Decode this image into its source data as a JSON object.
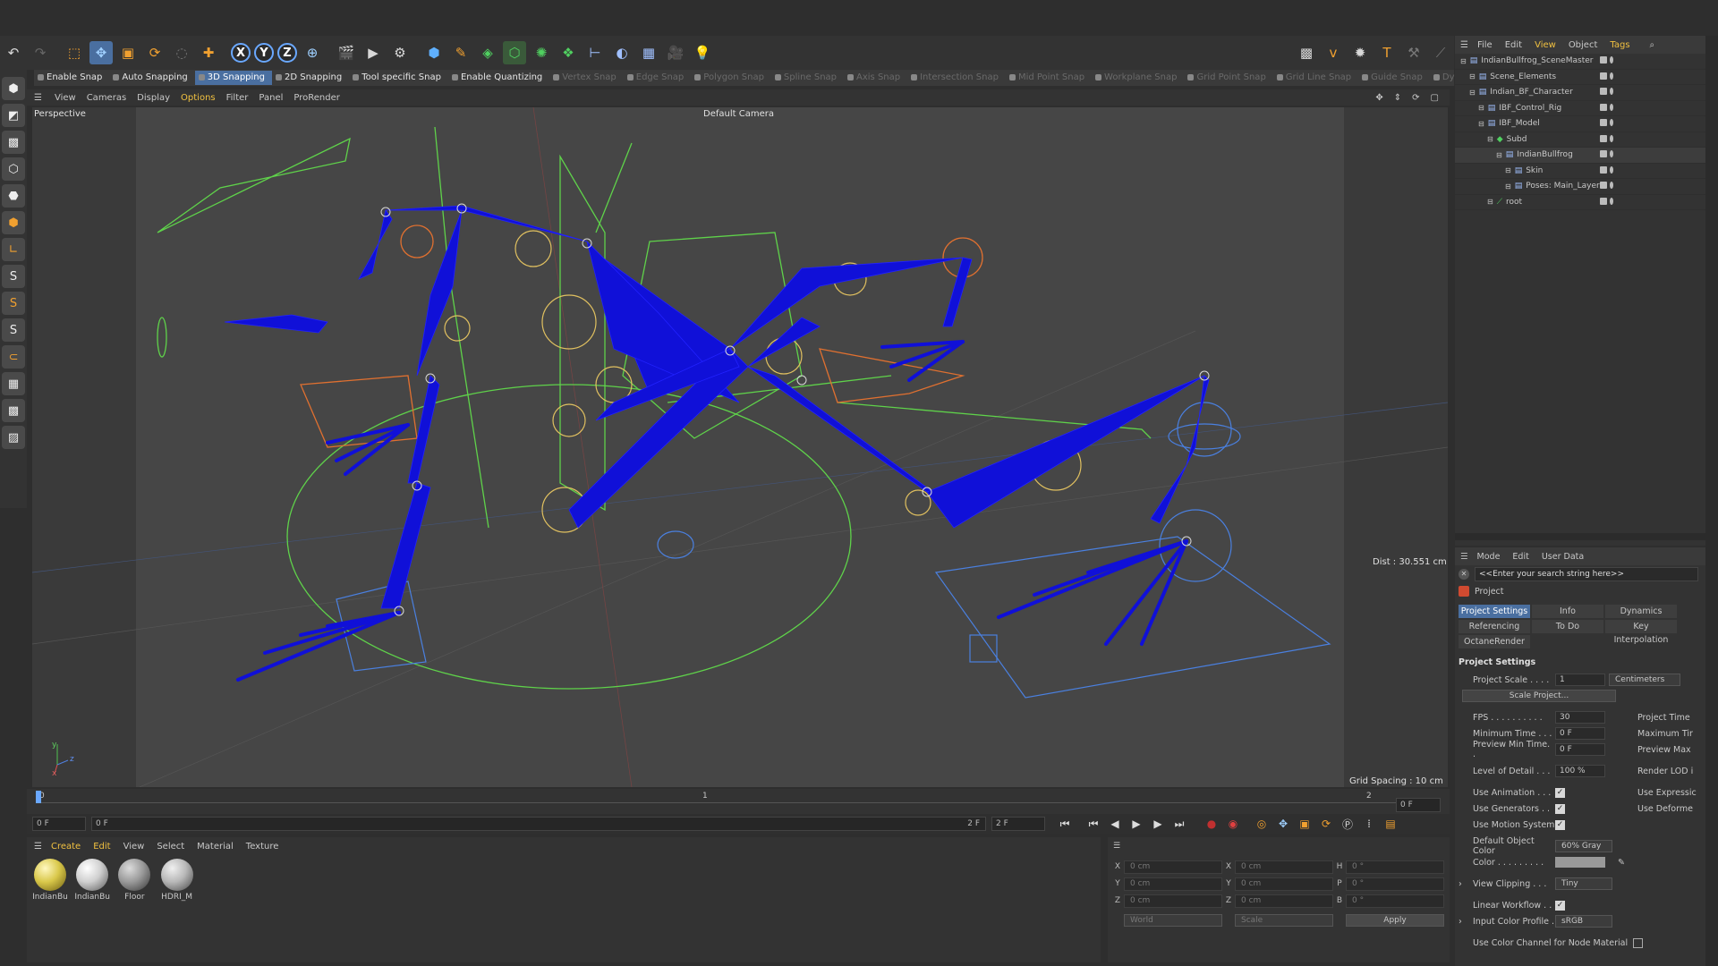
{
  "toolbar": {
    "axis_x": "X",
    "axis_y": "Y",
    "axis_z": "Z"
  },
  "snapbar": {
    "items": [
      "Enable Snap",
      "Auto Snapping",
      "3D Snapping",
      "2D Snapping",
      "Tool specific Snap",
      "Enable Quantizing",
      "Vertex Snap",
      "Edge Snap",
      "Polygon Snap",
      "Spline Snap",
      "Axis Snap",
      "Intersection Snap",
      "Mid Point Snap",
      "Workplane Snap",
      "Grid Point Snap",
      "Grid Line Snap",
      "Guide Snap",
      "Dynamic"
    ]
  },
  "viewport": {
    "menu": [
      "View",
      "Cameras",
      "Display",
      "Options",
      "Filter",
      "Panel",
      "ProRender"
    ],
    "projection": "Perspective",
    "camera": "Default Camera",
    "distance": "Dist : 30.551 cm",
    "grid_spacing": "Grid Spacing : 10 cm",
    "axis_y": "y",
    "axis_z": "z",
    "axis_x": "x"
  },
  "timeline": {
    "ticks": [
      "0",
      "1",
      "2"
    ],
    "current_frame": "0 F",
    "end_frame": "0 F",
    "start_field": "0 F",
    "range_start": "0 F",
    "range_end": "2 F",
    "max_field": "2 F"
  },
  "materials": {
    "menu": [
      "Create",
      "Edit",
      "View",
      "Select",
      "Material",
      "Texture"
    ],
    "items": [
      {
        "label": "IndianBu",
        "color": "#d9c84a"
      },
      {
        "label": "IndianBu",
        "color": "#cfcfcf"
      },
      {
        "label": "Floor",
        "color": "#9a9a9a"
      },
      {
        "label": "HDRI_M",
        "color": "#b8b8b8"
      }
    ]
  },
  "coordinates": {
    "rows": [
      {
        "a": "X",
        "av": "0 cm",
        "b": "X",
        "bv": "0 cm",
        "c": "H",
        "cv": "0 °"
      },
      {
        "a": "Y",
        "av": "0 cm",
        "b": "Y",
        "bv": "0 cm",
        "c": "P",
        "cv": "0 °"
      },
      {
        "a": "Z",
        "av": "0 cm",
        "b": "Z",
        "bv": "0 cm",
        "c": "B",
        "cv": "0 °"
      }
    ],
    "space": "World",
    "mode": "Scale",
    "apply": "Apply"
  },
  "objects": {
    "menu": [
      "File",
      "Edit",
      "View",
      "Object",
      "Tags"
    ],
    "rows": [
      {
        "name": "IndianBullfrog_SceneMaster",
        "indent": 0
      },
      {
        "name": "Scene_Elements",
        "indent": 1
      },
      {
        "name": "Indian_BF_Character",
        "indent": 1
      },
      {
        "name": "IBF_Control_Rig",
        "indent": 2
      },
      {
        "name": "IBF_Model",
        "indent": 2
      },
      {
        "name": "Subd",
        "indent": 3
      },
      {
        "name": "IndianBullfrog",
        "indent": 4
      },
      {
        "name": "Skin",
        "indent": 5
      },
      {
        "name": "Poses: Main_Layer",
        "indent": 5
      },
      {
        "name": "root",
        "indent": 3
      }
    ]
  },
  "attributes": {
    "menu": [
      "Mode",
      "Edit",
      "User Data"
    ],
    "search_placeholder": "<<Enter your search string here>>",
    "object_label": "Project",
    "tabs": [
      "Project Settings",
      "Info",
      "Dynamics",
      "Referencing",
      "To Do",
      "Key Interpolation",
      "OctaneRender"
    ],
    "section": "Project Settings",
    "project_scale_label": "Project Scale . . . .",
    "project_scale_value": "1",
    "project_scale_unit": "Centimeters",
    "scale_project_button": "Scale Project...",
    "fps_label": "FPS . . . . . . . . . .",
    "fps_value": "30",
    "project_time_label": "Project Time",
    "min_time_label": "Minimum Time . . .",
    "min_time_value": "0 F",
    "max_time_label": "Maximum Tir",
    "preview_min_label": "Preview Min Time. .",
    "preview_min_value": "0 F",
    "preview_max_label": "Preview Max",
    "lod_label": "Level of Detail . . .",
    "lod_value": "100 %",
    "render_lod_label": "Render LOD i",
    "use_animation_label": "Use Animation . . .",
    "use_expression_label": "Use Expressic",
    "use_generators_label": "Use Generators . .",
    "use_deformer_label": "Use Deforme",
    "use_motion_label": "Use Motion System",
    "default_color_label": "Default Object Color",
    "default_color_value": "60% Gray",
    "color_label": "Color . . . . . . . . .",
    "view_clipping_label": "View Clipping . . .",
    "view_clipping_value": "Tiny",
    "linear_workflow_label": "Linear Workflow . .",
    "input_profile_label": "Input Color Profile .",
    "input_profile_value": "sRGB",
    "node_material_label": "Use Color Channel for Node Material"
  },
  "colors": {
    "accent": "#4a6fa0",
    "bone": "#1010d8",
    "spline_green": "#5fd24a",
    "control_orange": "#e07030",
    "control_yellow": "#e0c060",
    "control_blue": "#4a80e0"
  }
}
